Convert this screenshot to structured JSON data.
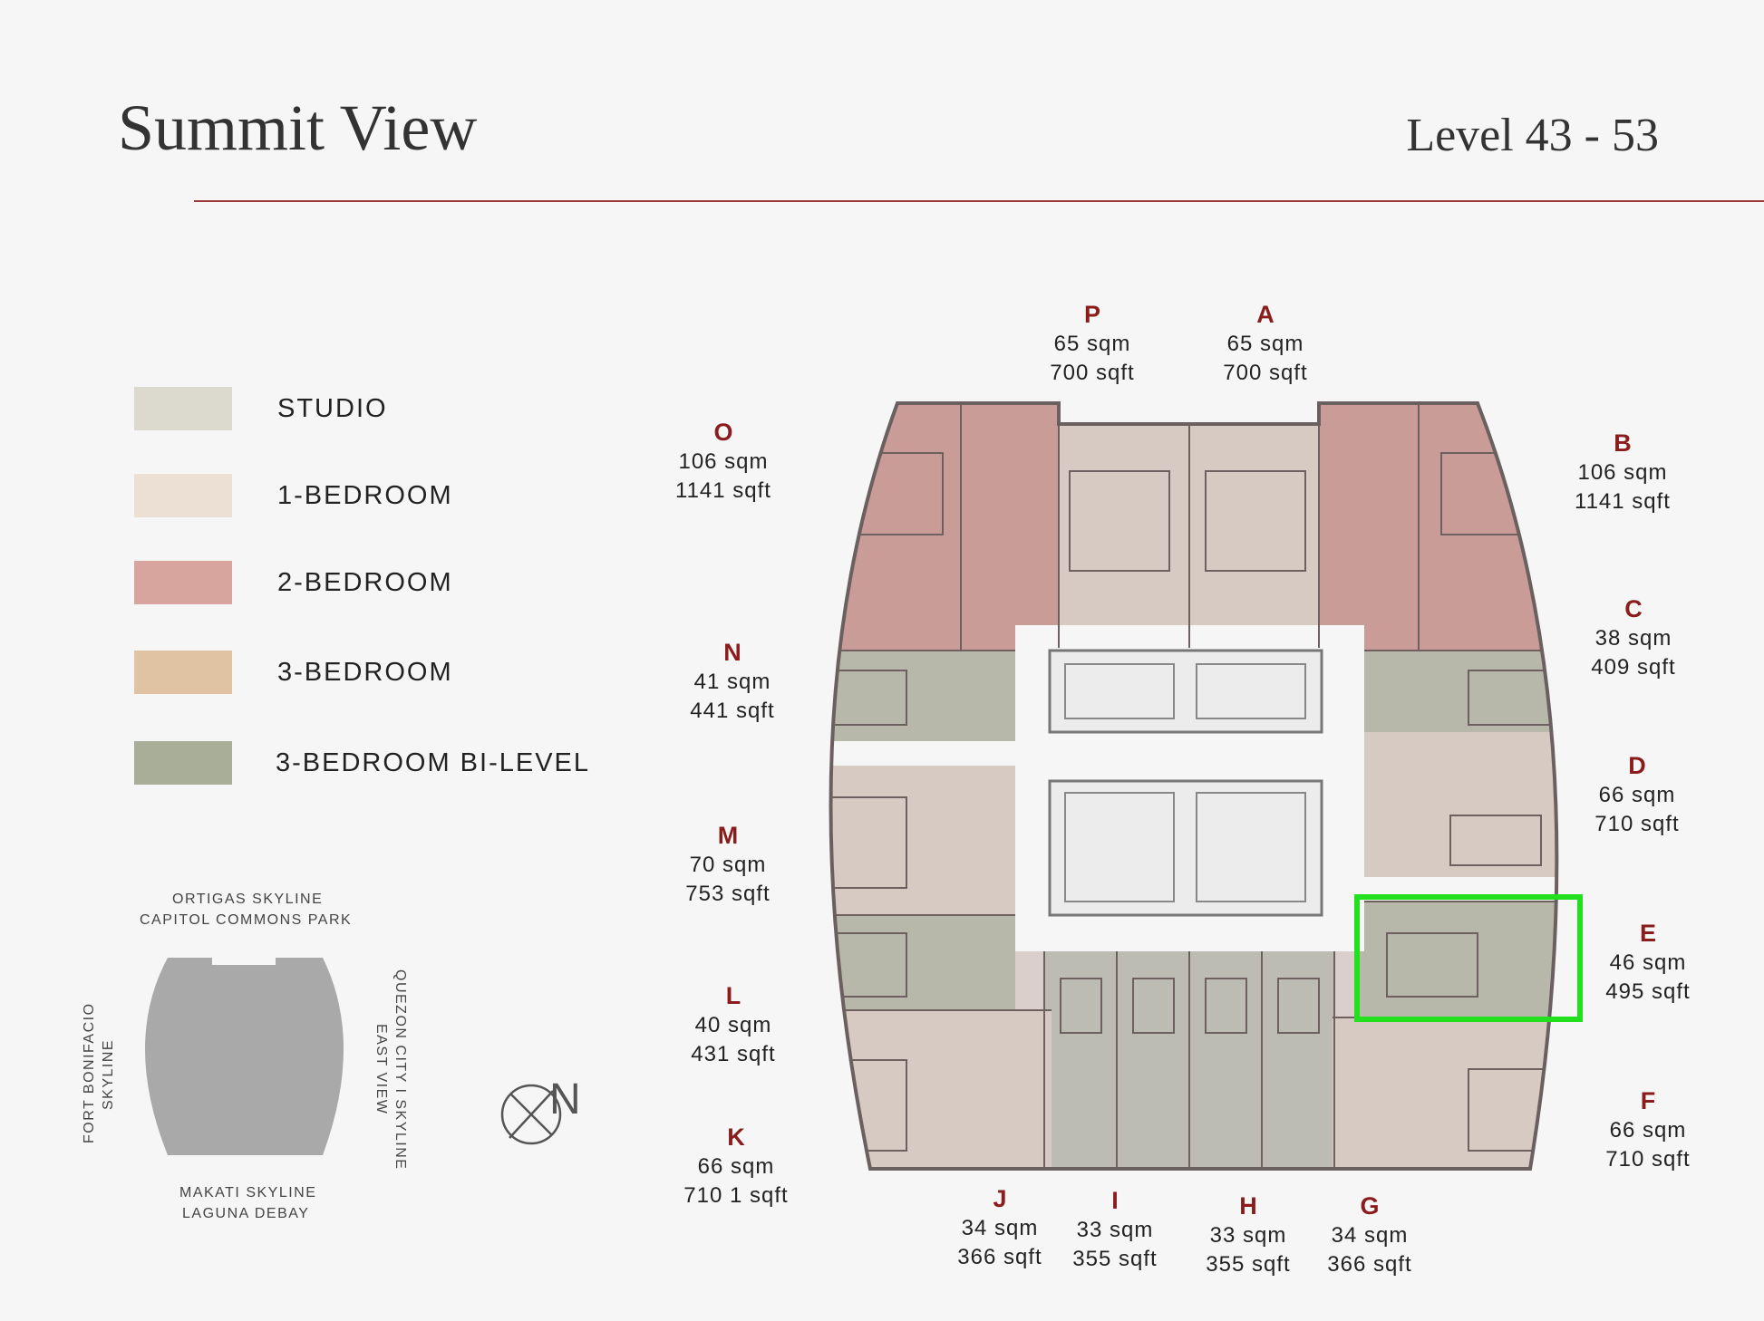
{
  "header": {
    "title": "Summit View",
    "level": "Level 43 - 53"
  },
  "legend": [
    {
      "label": "STUDIO",
      "color": "#dcd9cf"
    },
    {
      "label": "1-BEDROOM",
      "color": "#ecdfd4"
    },
    {
      "label": "2-BEDROOM",
      "color": "#d8a59e"
    },
    {
      "label": "3-BEDROOM",
      "color": "#dfc3a2"
    },
    {
      "label": "3-BEDROOM BI-LEVEL",
      "color": "#a9ae98"
    }
  ],
  "orientation": {
    "top": [
      "ORTIGAS  SKYLINE",
      "CAPITOL COMMONS PARK"
    ],
    "bottom": [
      "MAKATI  SKYLINE",
      "LAGUNA DEBAY"
    ],
    "left": [
      "FORT BONIFACIO",
      "SKYLINE"
    ],
    "right": [
      "QUEZON  CITY I SKYLINE",
      "EAST  VIEW"
    ],
    "north": "N"
  },
  "units": [
    {
      "id": "P",
      "sqm": "65 sqm",
      "sqft": "700 sqft"
    },
    {
      "id": "A",
      "sqm": "65 sqm",
      "sqft": "700 sqft"
    },
    {
      "id": "O",
      "sqm": "106 sqm",
      "sqft": "1141 sqft"
    },
    {
      "id": "B",
      "sqm": "106 sqm",
      "sqft": "1141 sqft"
    },
    {
      "id": "N",
      "sqm": "41 sqm",
      "sqft": "441 sqft"
    },
    {
      "id": "C",
      "sqm": "38 sqm",
      "sqft": "409 sqft"
    },
    {
      "id": "M",
      "sqm": "70 sqm",
      "sqft": "753 sqft"
    },
    {
      "id": "D",
      "sqm": "66 sqm",
      "sqft": "710 sqft"
    },
    {
      "id": "L",
      "sqm": "40 sqm",
      "sqft": "431 sqft"
    },
    {
      "id": "E",
      "sqm": "46 sqm",
      "sqft": "495 sqft"
    },
    {
      "id": "K",
      "sqm": "66 sqm",
      "sqft": "710 1 sqft"
    },
    {
      "id": "F",
      "sqm": "66 sqm",
      "sqft": "710 sqft"
    },
    {
      "id": "J",
      "sqm": "34 sqm",
      "sqft": "366 sqft"
    },
    {
      "id": "I",
      "sqm": "33 sqm",
      "sqft": "355 sqft"
    },
    {
      "id": "H",
      "sqm": "33 sqm",
      "sqft": "355 sqft"
    },
    {
      "id": "G",
      "sqm": "34 sqm",
      "sqft": "366 sqft"
    }
  ],
  "highlight": {
    "unit": "E",
    "color": "#22e01e"
  }
}
